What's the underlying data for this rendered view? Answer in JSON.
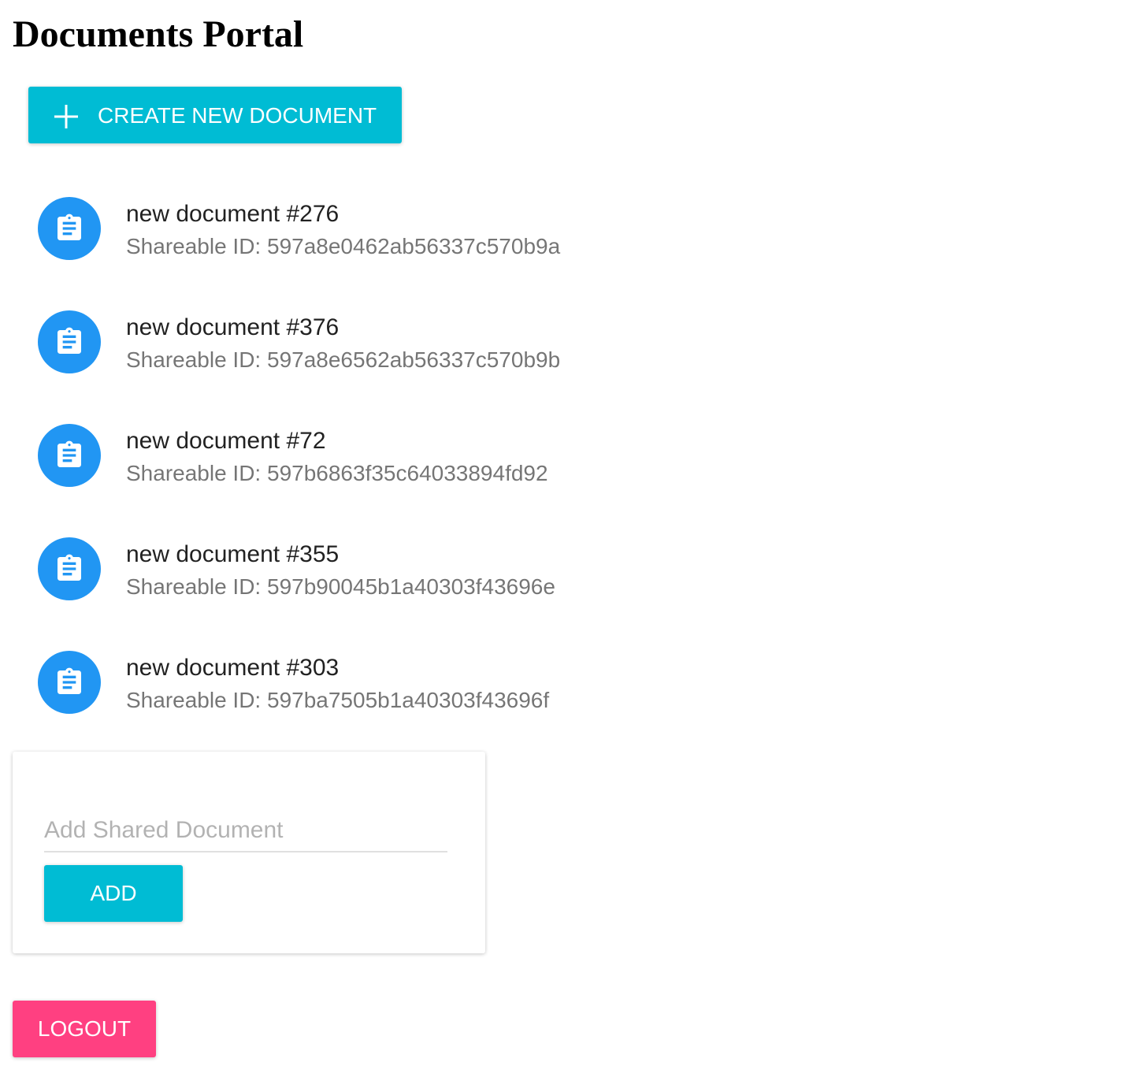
{
  "page": {
    "title": "Documents Portal"
  },
  "toolbar": {
    "create_label": "CREATE NEW DOCUMENT",
    "create_icon": "plus-icon"
  },
  "documents": [
    {
      "name": "new document #276",
      "shareable": "Shareable ID: 597a8e0462ab56337c570b9a",
      "icon": "clipboard-icon"
    },
    {
      "name": "new document #376",
      "shareable": "Shareable ID: 597a8e6562ab56337c570b9b",
      "icon": "clipboard-icon"
    },
    {
      "name": "new document #72",
      "shareable": "Shareable ID: 597b6863f35c64033894fd92",
      "icon": "clipboard-icon"
    },
    {
      "name": "new document #355",
      "shareable": "Shareable ID: 597b90045b1a40303f43696e",
      "icon": "clipboard-icon"
    },
    {
      "name": "new document #303",
      "shareable": "Shareable ID: 597ba7505b1a40303f43696f",
      "icon": "clipboard-icon"
    }
  ],
  "share": {
    "placeholder": "Add Shared Document",
    "value": "",
    "add_label": "ADD"
  },
  "auth": {
    "logout_label": "LOGOUT"
  },
  "colors": {
    "primary": "#00bcd4",
    "accent": "#ff4081",
    "avatar": "#2196f3"
  }
}
